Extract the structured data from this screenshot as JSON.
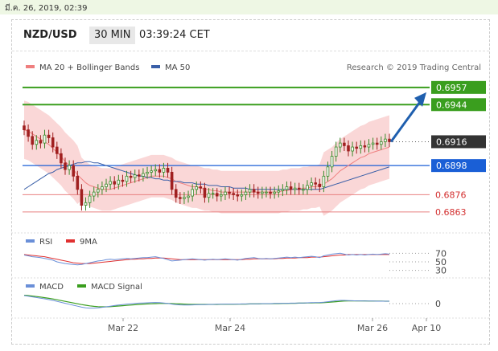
{
  "topbar": {
    "datetime": "มี.ค. 26, 2019, 02:39"
  },
  "header": {
    "pair": "NZD/USD",
    "timeframe": "30 MIN",
    "time": "03:39:24 CET"
  },
  "legend": {
    "ma20": "MA 20 + Bollinger Bands",
    "ma50": "MA 50",
    "credit": "Research © 2019 Trading Central",
    "rsi": "RSI",
    "rsi9": "9MA",
    "macd": "MACD",
    "macd_signal": "MACD Signal"
  },
  "colors": {
    "green_level": "#3a9e1e",
    "blue_level": "#1a5fd6",
    "red_level": "#e88080",
    "bollinger": "#f8caca",
    "ma20": "#ef7f7f",
    "ma50": "#3a5fa8",
    "up_candle": "#3a8a2a",
    "down_candle": "#a02020",
    "arrow": "#1f5fae",
    "rsi": "#6a8fd8",
    "rsi9": "#e03030",
    "macd": "#6a8fd8",
    "macd_signal": "#3a9e1e"
  },
  "chart_data": [
    {
      "type": "candlestick",
      "ylim": [
        0.6852,
        0.6966
      ],
      "x_labels": [
        "Mar 22",
        "Mar 24",
        "Mar 26",
        "Apr 10"
      ],
      "levels": [
        {
          "value": 0.6957,
          "label": "0.6957",
          "style": "green-box"
        },
        {
          "value": 0.6944,
          "label": "0.6944",
          "style": "green-box"
        },
        {
          "value": 0.6916,
          "label": "0.6916",
          "style": "dark-box-dotted"
        },
        {
          "value": 0.6898,
          "label": "0.6898",
          "style": "blue-box"
        },
        {
          "value": 0.6876,
          "label": "0.6876",
          "style": "red-text"
        },
        {
          "value": 0.6863,
          "label": "0.6863",
          "style": "red-text"
        }
      ],
      "close": [
        0.6925,
        0.692,
        0.6914,
        0.6917,
        0.6915,
        0.6921,
        0.6919,
        0.6912,
        0.6907,
        0.69,
        0.6895,
        0.6898,
        0.689,
        0.688,
        0.6868,
        0.687,
        0.6875,
        0.6878,
        0.688,
        0.6882,
        0.6884,
        0.6886,
        0.6884,
        0.6887,
        0.6886,
        0.689,
        0.6889,
        0.6891,
        0.689,
        0.6892,
        0.6893,
        0.6894,
        0.6895,
        0.6893,
        0.6896,
        0.6893,
        0.688,
        0.6874,
        0.6873,
        0.6874,
        0.6875,
        0.688,
        0.6882,
        0.6881,
        0.6874,
        0.6877,
        0.6877,
        0.6875,
        0.6876,
        0.6878,
        0.6877,
        0.6876,
        0.6875,
        0.6876,
        0.6878,
        0.688,
        0.6878,
        0.6877,
        0.6878,
        0.6878,
        0.6877,
        0.6878,
        0.6879,
        0.688,
        0.6882,
        0.688,
        0.6881,
        0.688,
        0.688,
        0.6883,
        0.6885,
        0.6884,
        0.6882,
        0.689,
        0.6897,
        0.6905,
        0.6912,
        0.6915,
        0.6913,
        0.6909,
        0.6912,
        0.6911,
        0.6913,
        0.6912,
        0.6914,
        0.6915,
        0.6914,
        0.6916,
        0.6918,
        0.6916
      ],
      "ma20": [
        0.6925,
        0.6924,
        0.6922,
        0.692,
        0.6918,
        0.6916,
        0.6914,
        0.6911,
        0.6908,
        0.6905,
        0.6901,
        0.6898,
        0.6895,
        0.6891,
        0.6888,
        0.6885,
        0.6883,
        0.6882,
        0.6881,
        0.688,
        0.688,
        0.688,
        0.6881,
        0.6882,
        0.6883,
        0.6884,
        0.6885,
        0.6886,
        0.6887,
        0.6888,
        0.6889,
        0.689,
        0.689,
        0.689,
        0.689,
        0.6889,
        0.6888,
        0.6886,
        0.6885,
        0.6884,
        0.6883,
        0.6882,
        0.6882,
        0.6881,
        0.688,
        0.688,
        0.6879,
        0.6879,
        0.6878,
        0.6878,
        0.6878,
        0.6878,
        0.6878,
        0.6878,
        0.6878,
        0.6878,
        0.6878,
        0.6878,
        0.6878,
        0.6878,
        0.6878,
        0.6878,
        0.6878,
        0.6879,
        0.6879,
        0.688,
        0.688,
        0.688,
        0.6881,
        0.6881,
        0.6882,
        0.6882,
        0.6883,
        0.6884,
        0.6886,
        0.6888,
        0.6891,
        0.6894,
        0.6896,
        0.6898,
        0.69,
        0.6902,
        0.6904,
        0.6905,
        0.6907,
        0.6908,
        0.6909,
        0.691,
        0.6911,
        0.6912
      ],
      "ma50": [
        0.688,
        0.6882,
        0.6884,
        0.6886,
        0.6888,
        0.689,
        0.6892,
        0.6893,
        0.6895,
        0.6896,
        0.6897,
        0.6898,
        0.6899,
        0.69,
        0.69,
        0.6901,
        0.6901,
        0.69,
        0.69,
        0.6899,
        0.6898,
        0.6897,
        0.6896,
        0.6895,
        0.6894,
        0.6893,
        0.6892,
        0.6891,
        0.689,
        0.689,
        0.6889,
        0.6889,
        0.6888,
        0.6888,
        0.6887,
        0.6887,
        0.6886,
        0.6886,
        0.6886,
        0.6885,
        0.6885,
        0.6885,
        0.6884,
        0.6884,
        0.6884,
        0.6883,
        0.6883,
        0.6883,
        0.6882,
        0.6882,
        0.6882,
        0.6881,
        0.6881,
        0.6881,
        0.6881,
        0.688,
        0.688,
        0.688,
        0.688,
        0.688,
        0.688,
        0.688,
        0.688,
        0.688,
        0.688,
        0.688,
        0.688,
        0.688,
        0.688,
        0.688,
        0.688,
        0.688,
        0.688,
        0.6881,
        0.6882,
        0.6883,
        0.6884,
        0.6885,
        0.6886,
        0.6887,
        0.6888,
        0.6889,
        0.689,
        0.6891,
        0.6892,
        0.6893,
        0.6894,
        0.6895,
        0.6896,
        0.6897
      ]
    },
    {
      "type": "line",
      "name": "RSI",
      "y_labels": [
        "70",
        "50",
        "30"
      ],
      "ylim": [
        20,
        80
      ],
      "series": [
        {
          "name": "RSI",
          "values": [
            66,
            64,
            62,
            61,
            60,
            58,
            56,
            54,
            50,
            48,
            46,
            45,
            44,
            43,
            44,
            46,
            48,
            50,
            52,
            53,
            55,
            56,
            55,
            56,
            57,
            58,
            57,
            58,
            59,
            60,
            60,
            61,
            62,
            60,
            58,
            55,
            52,
            53,
            54,
            55,
            56,
            57,
            56,
            55,
            54,
            55,
            56,
            55,
            56,
            57,
            56,
            55,
            54,
            56,
            58,
            59,
            60,
            58,
            57,
            58,
            57,
            58,
            59,
            60,
            61,
            60,
            61,
            60,
            61,
            62,
            63,
            62,
            60,
            64,
            66,
            68,
            69,
            70,
            68,
            66,
            67,
            66,
            67,
            66,
            67,
            68,
            67,
            68,
            69,
            68
          ]
        },
        {
          "name": "9MA",
          "values": [
            67,
            66,
            65,
            64,
            63,
            62,
            60,
            58,
            56,
            54,
            52,
            50,
            48,
            47,
            46,
            46,
            46,
            47,
            48,
            49,
            50,
            51,
            52,
            53,
            54,
            55,
            56,
            56,
            57,
            57,
            58,
            58,
            59,
            59,
            59,
            58,
            57,
            56,
            55,
            55,
            55,
            55,
            55,
            55,
            55,
            55,
            55,
            55,
            55,
            55,
            55,
            55,
            55,
            55,
            56,
            56,
            57,
            57,
            57,
            57,
            57,
            57,
            58,
            58,
            59,
            59,
            59,
            60,
            60,
            60,
            61,
            61,
            61,
            62,
            63,
            64,
            65,
            66,
            66,
            67,
            67,
            67,
            67,
            67,
            67,
            67,
            67,
            67,
            67,
            67
          ]
        }
      ]
    },
    {
      "type": "line",
      "name": "MACD",
      "y_labels": [
        "0"
      ],
      "ylim": [
        -8,
        8
      ],
      "series": [
        {
          "name": "MACD",
          "values": [
            5,
            4.6,
            4.2,
            3.8,
            3.4,
            3.0,
            2.5,
            2.0,
            1.4,
            0.8,
            0.2,
            -0.4,
            -1.0,
            -1.6,
            -2.2,
            -2.6,
            -2.8,
            -2.8,
            -2.6,
            -2.3,
            -2.0,
            -1.6,
            -1.2,
            -0.9,
            -0.6,
            -0.3,
            -0.1,
            0.1,
            0.3,
            0.4,
            0.5,
            0.6,
            0.7,
            0.6,
            0.4,
            0.1,
            -0.3,
            -0.6,
            -0.8,
            -0.9,
            -0.9,
            -0.8,
            -0.7,
            -0.6,
            -0.6,
            -0.5,
            -0.5,
            -0.4,
            -0.4,
            -0.3,
            -0.3,
            -0.3,
            -0.3,
            -0.2,
            -0.2,
            -0.1,
            -0.1,
            -0.1,
            0,
            0,
            0,
            0.1,
            0.1,
            0.2,
            0.2,
            0.3,
            0.3,
            0.4,
            0.4,
            0.5,
            0.6,
            0.6,
            0.7,
            0.9,
            1.2,
            1.5,
            1.8,
            2.0,
            2.0,
            1.9,
            1.8,
            1.7,
            1.7,
            1.6,
            1.6,
            1.6,
            1.5,
            1.5,
            1.5,
            1.5
          ]
        },
        {
          "name": "MACD Signal",
          "values": [
            5.2,
            5.0,
            4.7,
            4.4,
            4.1,
            3.7,
            3.3,
            2.9,
            2.4,
            1.9,
            1.4,
            0.9,
            0.4,
            -0.1,
            -0.6,
            -1.0,
            -1.4,
            -1.7,
            -1.9,
            -2.0,
            -2.0,
            -1.9,
            -1.7,
            -1.5,
            -1.3,
            -1.1,
            -0.9,
            -0.7,
            -0.5,
            -0.3,
            -0.2,
            -0.1,
            0,
            0.1,
            0.1,
            0.1,
            0,
            -0.1,
            -0.2,
            -0.3,
            -0.4,
            -0.5,
            -0.5,
            -0.5,
            -0.5,
            -0.5,
            -0.5,
            -0.5,
            -0.4,
            -0.4,
            -0.4,
            -0.4,
            -0.3,
            -0.3,
            -0.3,
            -0.2,
            -0.2,
            -0.2,
            -0.1,
            -0.1,
            -0.1,
            0,
            0,
            0.1,
            0.1,
            0.2,
            0.2,
            0.3,
            0.3,
            0.4,
            0.4,
            0.5,
            0.5,
            0.6,
            0.8,
            1.0,
            1.2,
            1.4,
            1.6,
            1.7,
            1.7,
            1.7,
            1.7,
            1.7,
            1.6,
            1.6,
            1.6,
            1.6,
            1.5,
            1.5
          ]
        }
      ]
    }
  ]
}
